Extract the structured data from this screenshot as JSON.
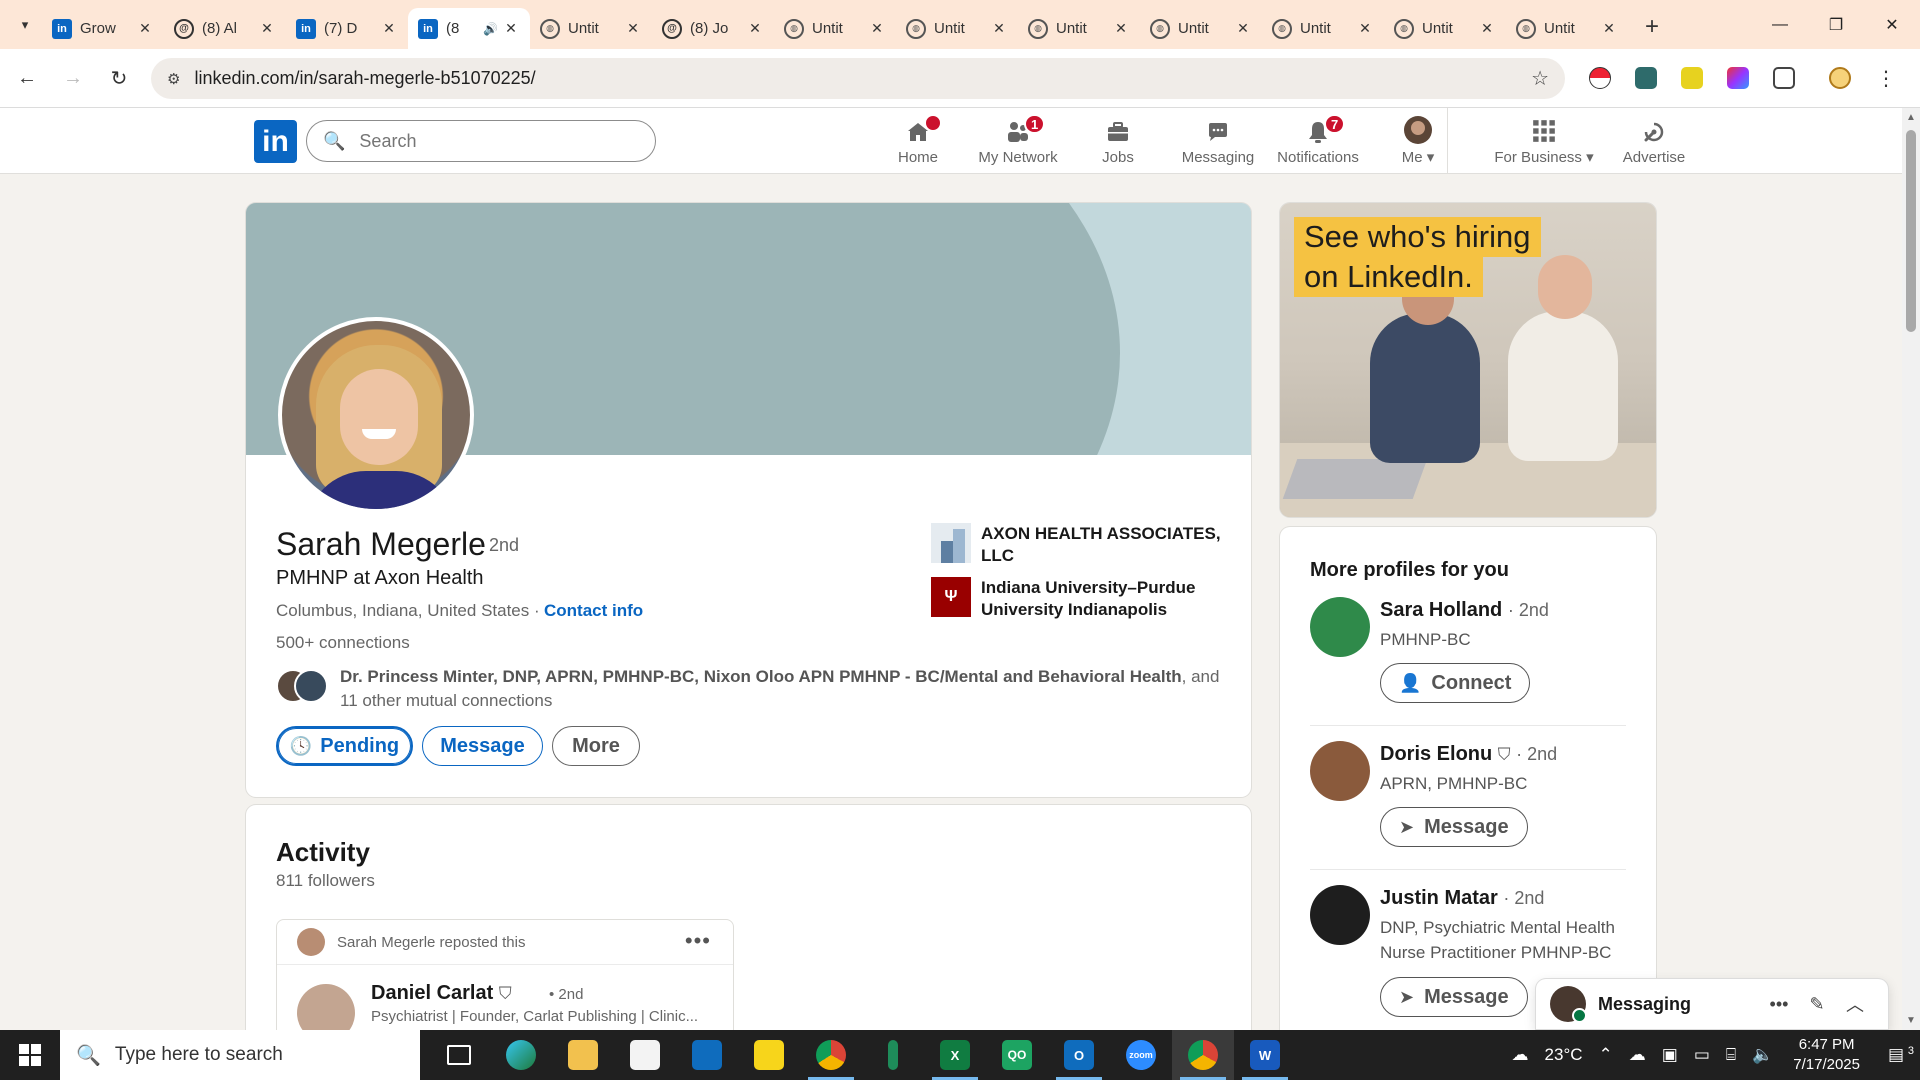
{
  "browser": {
    "tabs": [
      {
        "title": "Grow",
        "icon": "linkedin-icon"
      },
      {
        "title": "(8) Al",
        "icon": "at-icon"
      },
      {
        "title": "(7) D",
        "icon": "linkedin-icon"
      },
      {
        "title": "(8",
        "icon": "linkedin-icon",
        "active": true
      },
      {
        "title": "Untit",
        "icon": "globe-icon"
      },
      {
        "title": "(8) Jo",
        "icon": "at-icon"
      },
      {
        "title": "Untit",
        "icon": "globe-icon"
      },
      {
        "title": "Untit",
        "icon": "globe-icon"
      },
      {
        "title": "Untit",
        "icon": "globe-icon"
      },
      {
        "title": "Untit",
        "icon": "globe-icon"
      },
      {
        "title": "Untit",
        "icon": "globe-icon"
      },
      {
        "title": "Untit",
        "icon": "globe-icon"
      },
      {
        "title": "Untit",
        "icon": "globe-icon"
      }
    ],
    "url": "linkedin.com/in/sarah-megerle-b51070225/"
  },
  "header": {
    "logo": "in",
    "search_placeholder": "Search",
    "nav": [
      {
        "label": "Home",
        "badge": ""
      },
      {
        "label": "My Network",
        "badge": "1"
      },
      {
        "label": "Jobs",
        "badge": ""
      },
      {
        "label": "Messaging",
        "badge": ""
      },
      {
        "label": "Notifications",
        "badge": "7"
      },
      {
        "label": "Me ▾",
        "badge": ""
      },
      {
        "label": "For Business ▾",
        "badge": ""
      },
      {
        "label": "Advertise",
        "badge": ""
      }
    ]
  },
  "profile": {
    "name": "Sarah Megerle",
    "degree": "· 2nd",
    "headline": "PMHNP at Axon Health",
    "location": "Columbus, Indiana, United States ·",
    "contact_info": "Contact info",
    "connections": "500+ connections",
    "mutual_names": "Dr. Princess Minter, DNP, APRN, PMHNP-BC, Nixon Oloo APN PMHNP - BC/Mental and Behavioral Health",
    "mutual_rest": ", and 11 other mutual connections",
    "buttons": {
      "pending": "Pending",
      "message": "Message",
      "more": "More"
    },
    "orgs": [
      {
        "name": "AXON HEALTH ASSOCIATES, LLC"
      },
      {
        "name": "Indiana University–Purdue University Indianapolis"
      }
    ]
  },
  "activity": {
    "title": "Activity",
    "followers": "811 followers",
    "post": {
      "repost_text": "Sarah Megerle reposted this",
      "author": "Daniel Carlat",
      "author_degree": "• 2nd",
      "author_headline": "Psychiatrist | Founder, Carlat Publishing | Clinic..."
    }
  },
  "ad": {
    "line1": "See who's hiring",
    "line2": "on LinkedIn."
  },
  "more_profiles": {
    "title": "More profiles for you",
    "people": [
      {
        "name": "Sara Holland",
        "degree": "· 2nd",
        "headline": "PMHNP-BC",
        "action": "Connect",
        "verified": false,
        "avatar_color": "#2f8a4a"
      },
      {
        "name": "Doris Elonu",
        "degree": "· 2nd",
        "headline": "APRN, PMHNP-BC",
        "action": "Message",
        "verified": true,
        "avatar_color": "#8a5a3c"
      },
      {
        "name": "Justin Matar",
        "degree": "· 2nd",
        "headline": "DNP, Psychiatric Mental Health Nurse Practitioner PMHNP-BC",
        "action": "Message",
        "verified": false,
        "avatar_color": "#1e1e1e"
      }
    ]
  },
  "messaging": {
    "label": "Messaging"
  },
  "taskbar": {
    "search_placeholder": "Type here to search",
    "weather": "23°C",
    "time": "6:47 PM",
    "date": "7/17/2025",
    "notifications": "3"
  },
  "colors": {
    "linkedin_blue": "#0a66c2",
    "badge_red": "#cb112d",
    "tab_strip": "#fde7d7",
    "page_bg": "#f4f2ee"
  }
}
